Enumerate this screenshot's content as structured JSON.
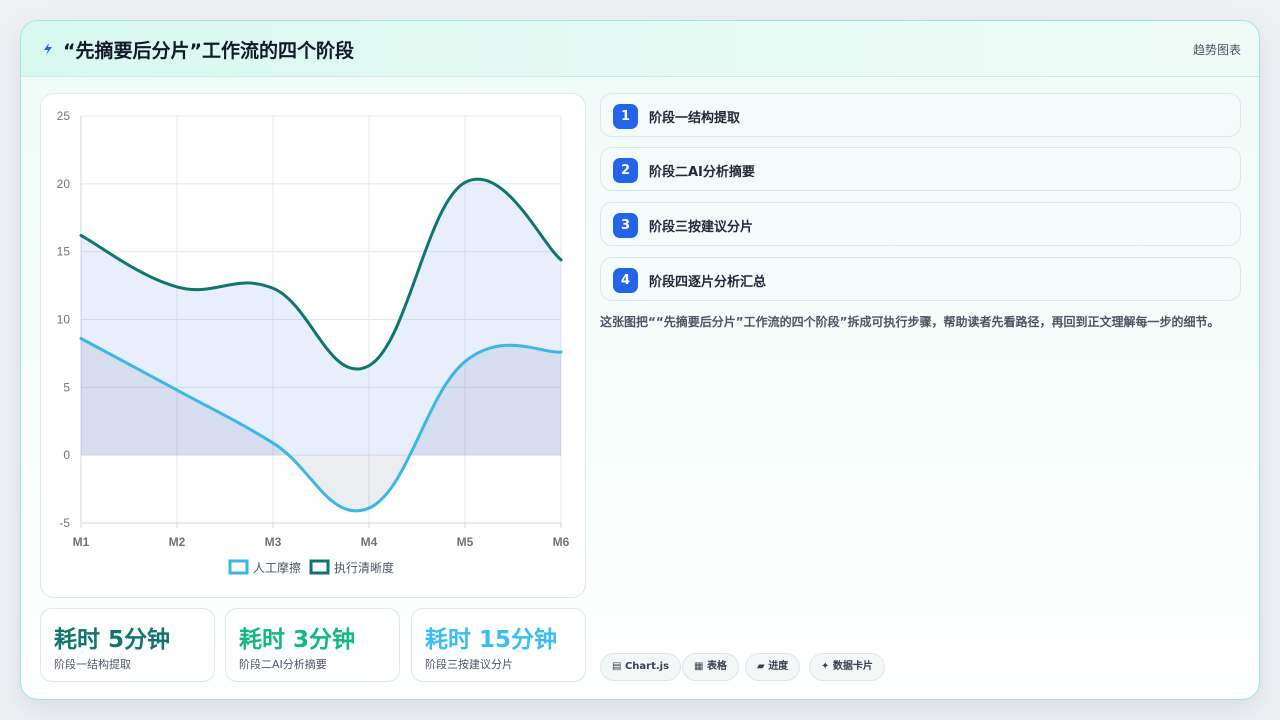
{
  "header": {
    "title": "“先摘要后分片”工作流的四个阶段",
    "tag": "趋势图表",
    "icon": "lightning-icon"
  },
  "chart_data": {
    "type": "line",
    "categories": [
      "M1",
      "M2",
      "M3",
      "M4",
      "M5",
      "M6"
    ],
    "series": [
      {
        "name": "人工摩擦",
        "values": [
          8.6,
          4.8,
          0.9,
          -3.9,
          6.9,
          7.6
        ],
        "color": "#3bb6e6",
        "fill": true
      },
      {
        "name": "执行清晰度",
        "values": [
          16.2,
          12.4,
          12.3,
          6.6,
          20.1,
          14.4
        ],
        "color": "#0f766e",
        "fill": true
      }
    ],
    "ylim": [
      -5,
      25
    ],
    "yticks": [
      "25",
      "20",
      "15",
      "10",
      "5",
      "0",
      "-5"
    ],
    "grid": true,
    "legend": "bottom",
    "smooth": true
  },
  "stats": [
    {
      "value": "耗时 5分钟",
      "label": "阶段一结构提取",
      "color": "#0f766e"
    },
    {
      "value": "耗时 3分钟",
      "label": "阶段二AI分析摘要",
      "color": "#10b981"
    },
    {
      "value": "耗时 15分钟",
      "label": "阶段三按建议分片",
      "color": "#38bdf8"
    }
  ],
  "steps": [
    {
      "num": "1",
      "label": "阶段一结构提取"
    },
    {
      "num": "2",
      "label": "阶段二AI分析摘要"
    },
    {
      "num": "3",
      "label": "阶段三按建议分片"
    },
    {
      "num": "4",
      "label": "阶段四逐片分析汇总"
    }
  ],
  "description": "这张图把““先摘要后分片”工作流的四个阶段”拆成可执行步骤，帮助读者先看路径，再回到正文理解每一步的细节。",
  "tags": [
    {
      "icon": "chart-icon",
      "glyph": "▤",
      "label": "Chart.js"
    },
    {
      "icon": "table-icon",
      "glyph": "▦",
      "label": "表格"
    },
    {
      "icon": "progress-icon",
      "glyph": "▰",
      "label": "进度"
    },
    {
      "icon": "sparkle-icon",
      "glyph": "✦",
      "label": "数据卡片"
    }
  ]
}
